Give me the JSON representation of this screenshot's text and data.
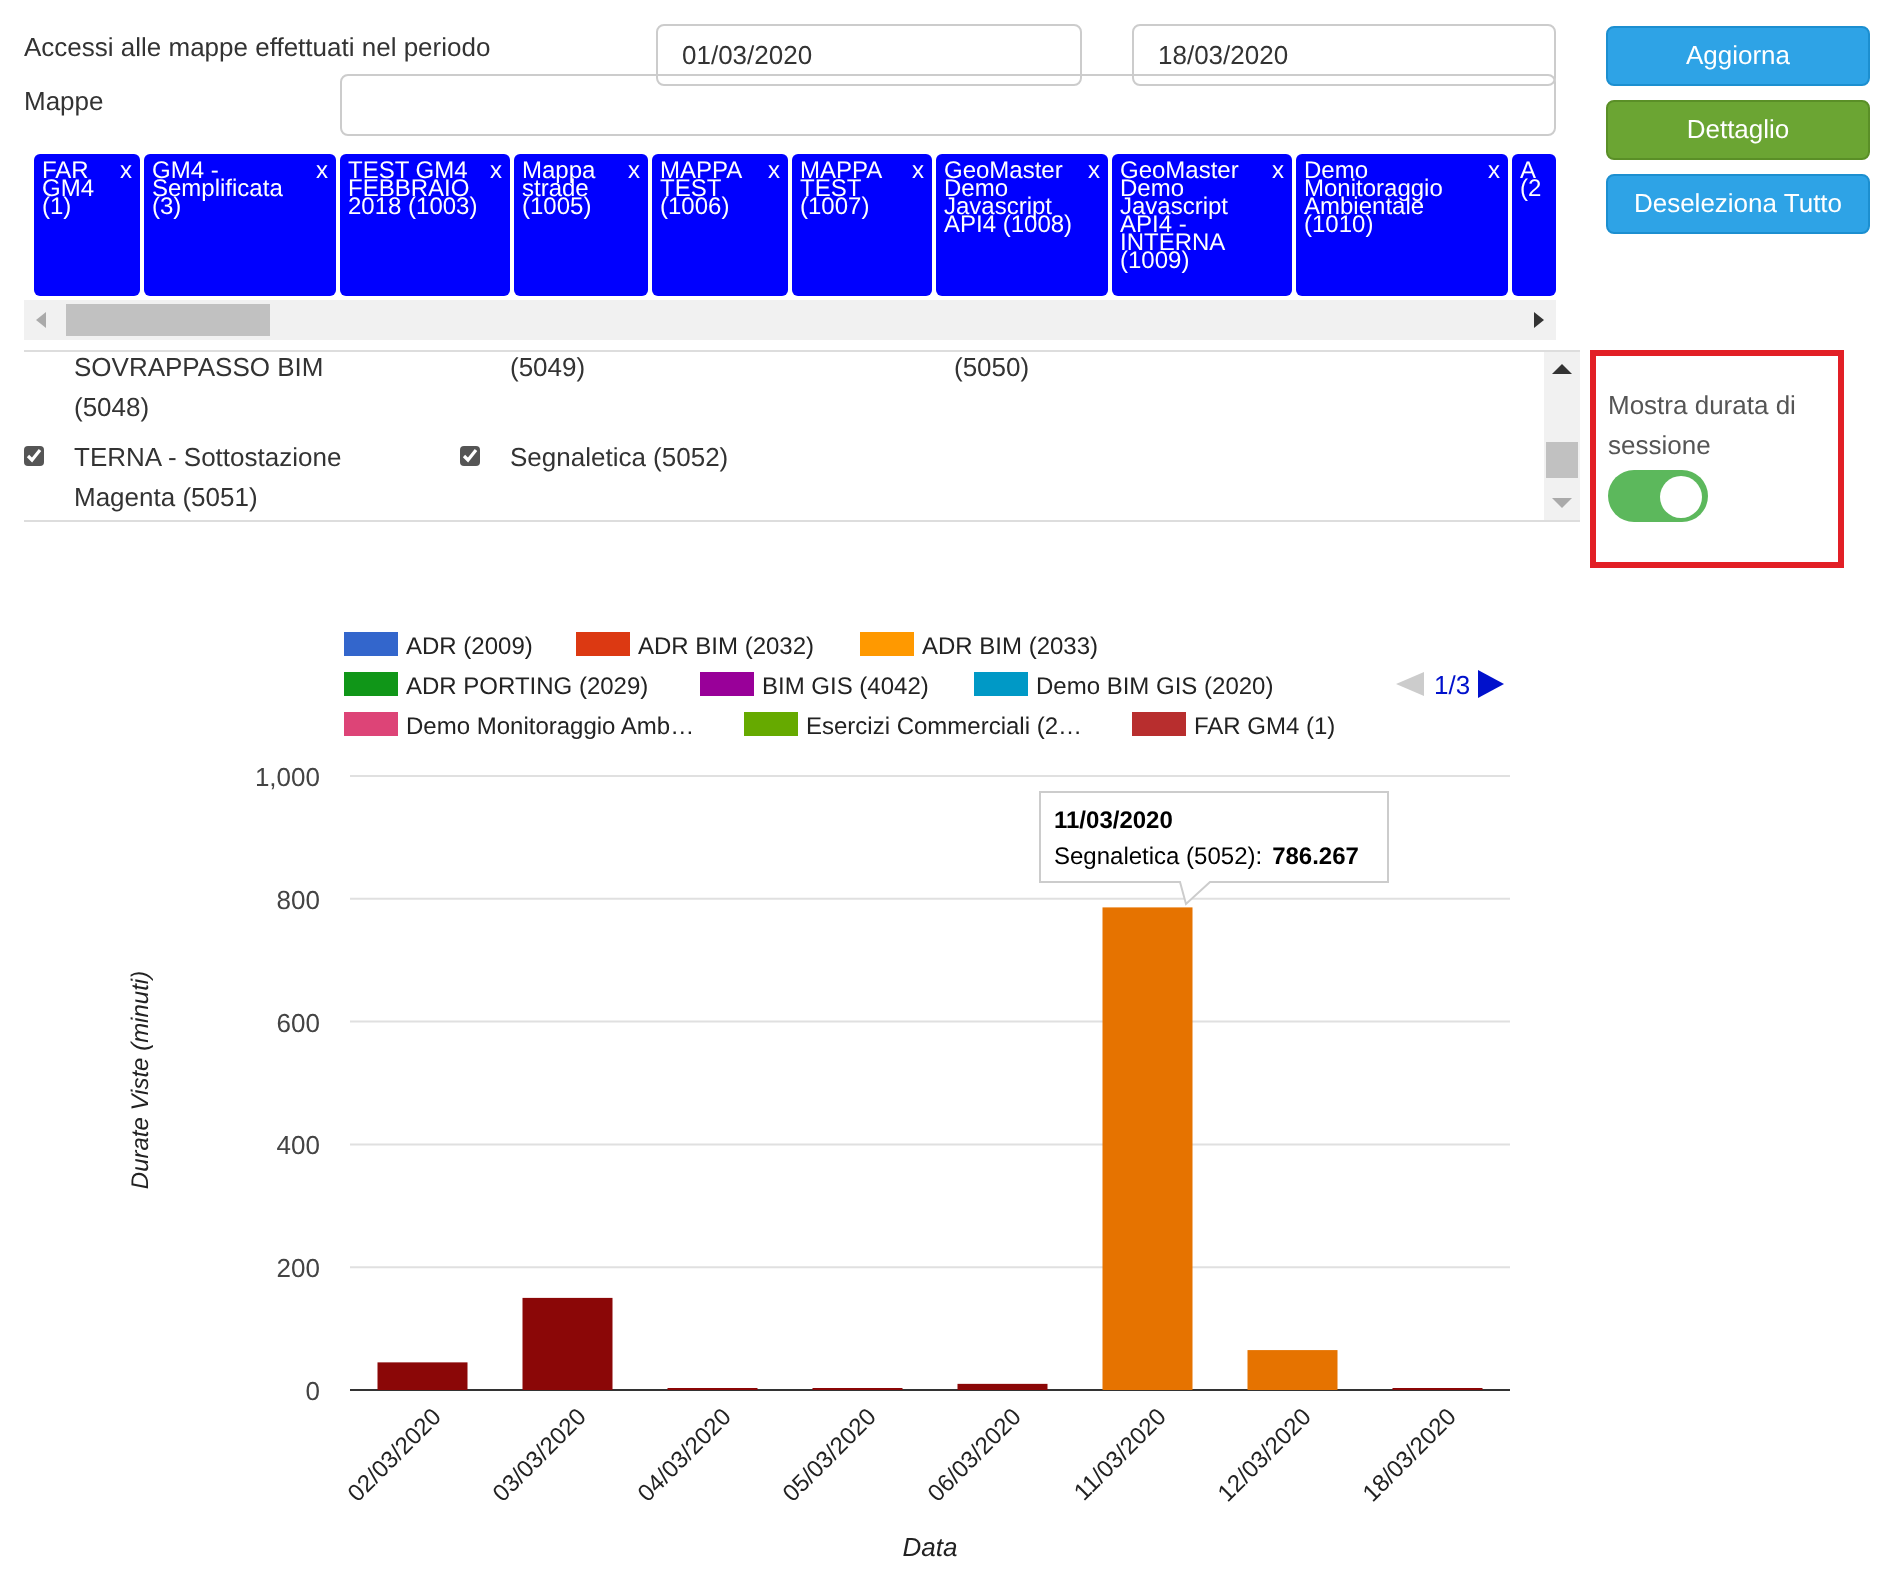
{
  "period": {
    "label": "Accessi alle mappe effettuati nel periodo",
    "from": "01/03/2020",
    "to": "18/03/2020"
  },
  "maps": {
    "label": "Mappe"
  },
  "tags": [
    {
      "label": "FAR GM4 (1)",
      "close": "x"
    },
    {
      "label": "GM4 - Semplificata (3)",
      "close": "x"
    },
    {
      "label": "TEST GM4 FEBBRAIO 2018 (1003)",
      "close": "x"
    },
    {
      "label": "Mappa strade (1005)",
      "close": "x"
    },
    {
      "label": "MAPPA TEST (1006)",
      "close": "x"
    },
    {
      "label": "MAPPA TEST (1007)",
      "close": "x"
    },
    {
      "label": "GeoMaster Demo Javascript API4 (1008)",
      "close": "x"
    },
    {
      "label": "GeoMaster Demo Javascript API4 - INTERNA (1009)",
      "close": "x"
    },
    {
      "label": "Demo Monitoraggio Ambientale (1010)",
      "close": "x"
    },
    {
      "label": "A (2"
    }
  ],
  "map_list": [
    {
      "label": "SOVRAPPASSO BIM (5048)"
    },
    {
      "label": "(5049)"
    },
    {
      "label": "(5050)"
    },
    {
      "label": "TERNA - Sottostazione Magenta (5051)",
      "checked": true
    },
    {
      "label": "Segnaletica (5052)",
      "checked": true
    }
  ],
  "buttons": [
    {
      "label": "Aggiorna",
      "kind": "primary"
    },
    {
      "label": "Dettaglio",
      "kind": "success"
    },
    {
      "label": "Deseleziona Tutto",
      "kind": "primary"
    }
  ],
  "session_toggle": {
    "label": "Mostra durata di sessione",
    "on": true
  },
  "legend": {
    "items": [
      {
        "label": "ADR (2009)",
        "color": "#3366cc"
      },
      {
        "label": "ADR BIM (2032)",
        "color": "#dc3912"
      },
      {
        "label": "ADR BIM (2033)",
        "color": "#ff9900"
      },
      {
        "label": "ADR PORTING (2029)",
        "color": "#109618"
      },
      {
        "label": "BIM GIS (4042)",
        "color": "#990099"
      },
      {
        "label": "Demo BIM GIS (2020)",
        "color": "#0099c6"
      },
      {
        "label": "Demo Monitoraggio Amb…",
        "color": "#dd4477"
      },
      {
        "label": "Esercizi Commerciali (2…",
        "color": "#66aa00"
      },
      {
        "label": "FAR GM4 (1)",
        "color": "#b82e2e"
      }
    ],
    "page": "1/3"
  },
  "chart_data": {
    "type": "bar",
    "grid": true,
    "xlabel": "Data",
    "ylabel": "Durate Viste (minuti)",
    "categories": [
      "02/03/2020",
      "03/03/2020",
      "04/03/2020",
      "05/03/2020",
      "06/03/2020",
      "11/03/2020",
      "12/03/2020",
      "18/03/2020"
    ],
    "series": [
      {
        "color": "#8b0707",
        "values": [
          45,
          150,
          0,
          0,
          10,
          null,
          null,
          0
        ]
      },
      {
        "color": "#e67300",
        "values": [
          null,
          null,
          null,
          null,
          null,
          786,
          65,
          null
        ]
      }
    ],
    "ylim": [
      0,
      1000
    ],
    "yticks": [
      {
        "value": 0,
        "label": "0"
      },
      {
        "value": 200,
        "label": "200"
      },
      {
        "value": 400,
        "label": "400"
      },
      {
        "value": 600,
        "label": "600"
      },
      {
        "value": 800,
        "label": "800"
      },
      {
        "value": 1000,
        "label": "1,000"
      }
    ]
  },
  "tooltip": {
    "title": "11/03/2020",
    "label": "Segnaletica (5052):",
    "value": "786.267"
  }
}
